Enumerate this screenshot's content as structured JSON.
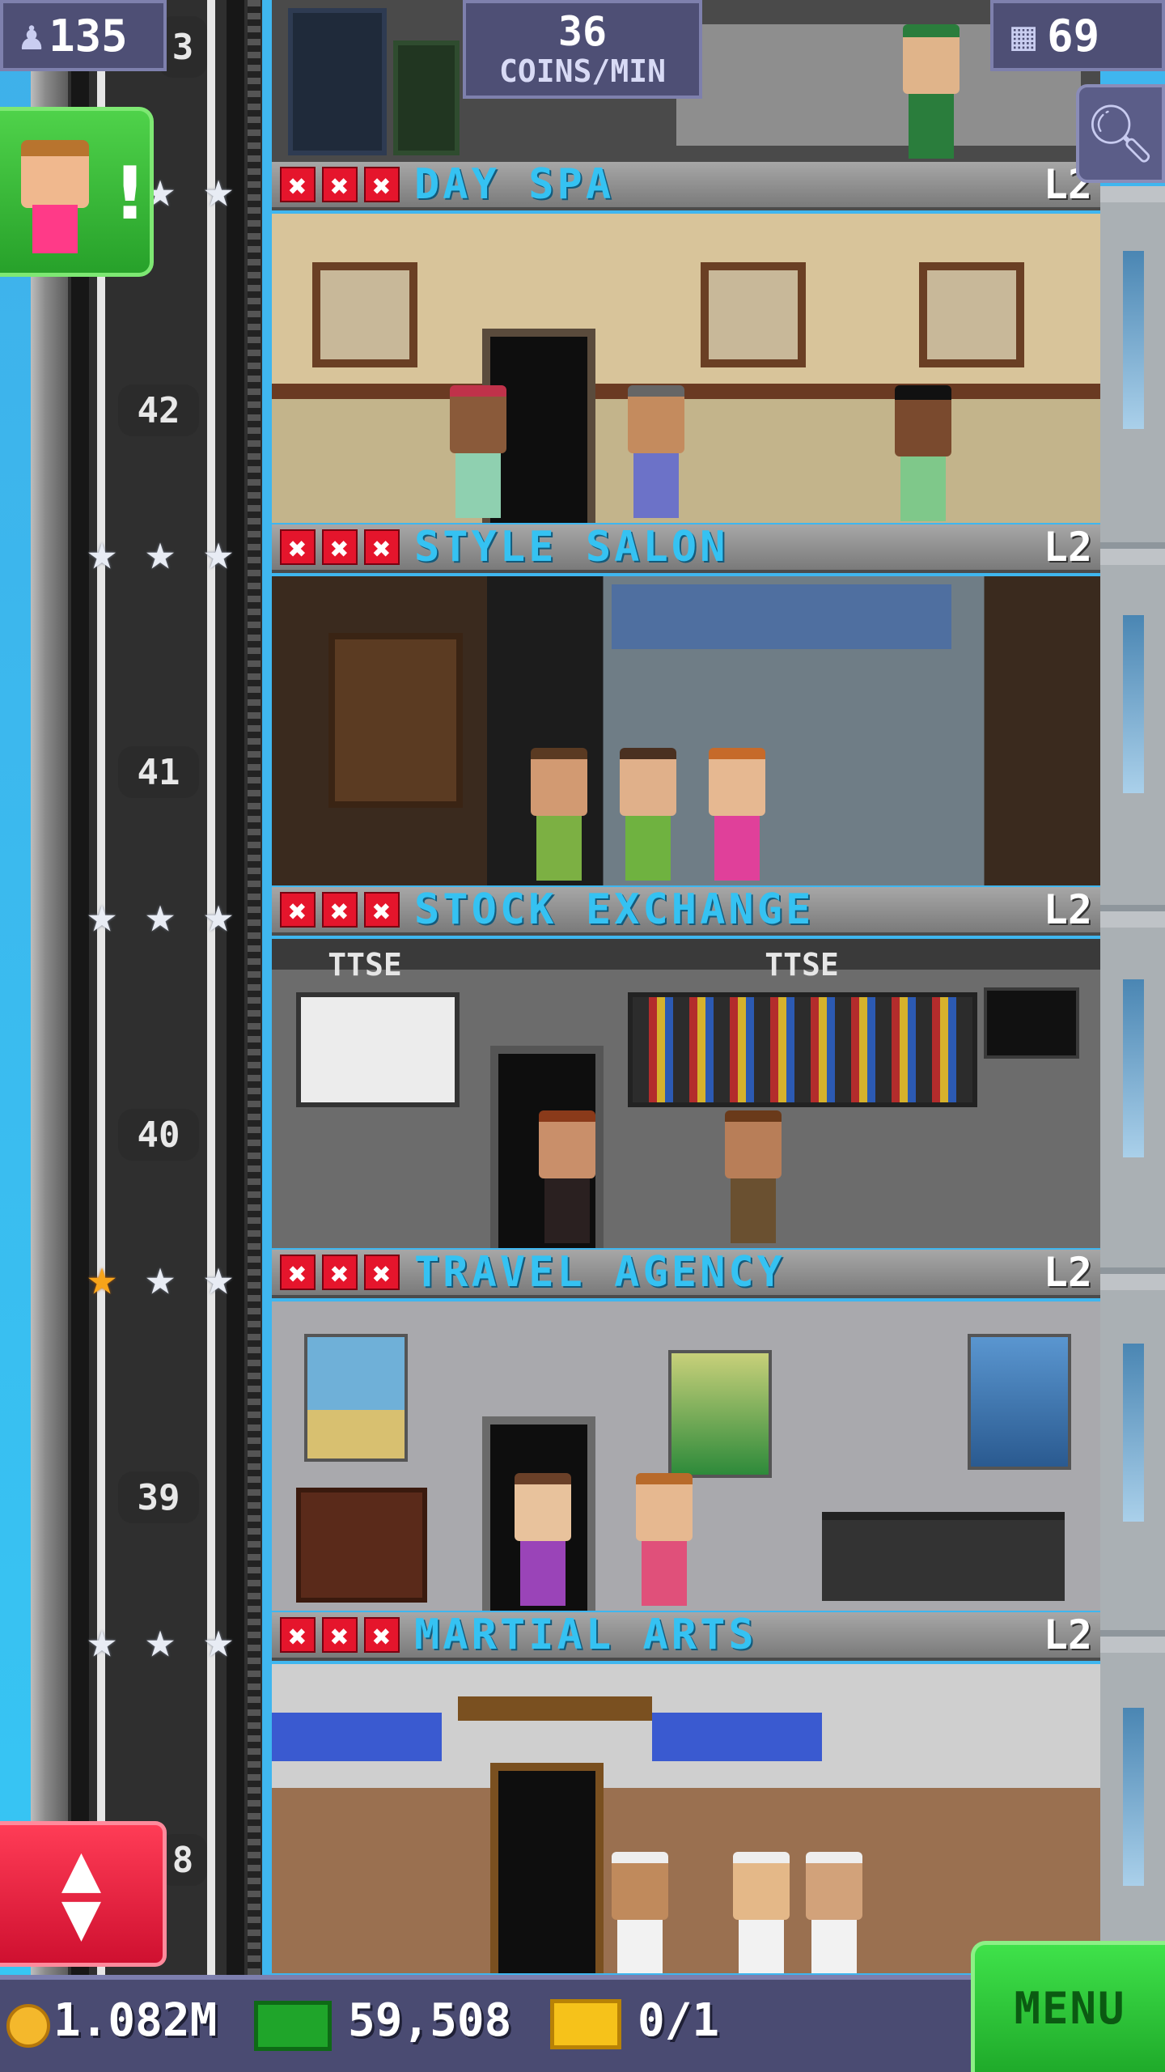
{
  "hud": {
    "population": "135",
    "coins_rate_value": "36",
    "coins_rate_unit": "COINS/MIN",
    "floors_count": "69"
  },
  "elevator": {
    "floor_numbers": [
      "42",
      "41",
      "40",
      "39"
    ],
    "partial_top": "3",
    "partial_bottom": "8"
  },
  "rooms": [
    {
      "name": "DAY SPA",
      "level": "L2",
      "stars_gold": 0
    },
    {
      "name": "STYLE SALON",
      "level": "L2",
      "stars_gold": 0
    },
    {
      "name": "STOCK EXCHANGE",
      "level": "L2",
      "stars_gold": 0
    },
    {
      "name": "TRAVEL AGENCY",
      "level": "L2",
      "stars_gold": 1
    },
    {
      "name": "MARTIAL ARTS",
      "level": "L2",
      "stars_gold": 0
    }
  ],
  "signs": {
    "stock_exchange_sign": "TTSE"
  },
  "notification": {
    "mark": "!"
  },
  "bottom": {
    "coins": "1.082M",
    "bux": "59,508",
    "tickets": "0/1",
    "menu_label": "MENU"
  },
  "colors": {
    "room_name": "#35c2f2",
    "menu_green": "#2fd23a",
    "alert_green": "#3fc43c",
    "elevator_red": "#e8203c",
    "hud_bg": "#4e4f75"
  }
}
